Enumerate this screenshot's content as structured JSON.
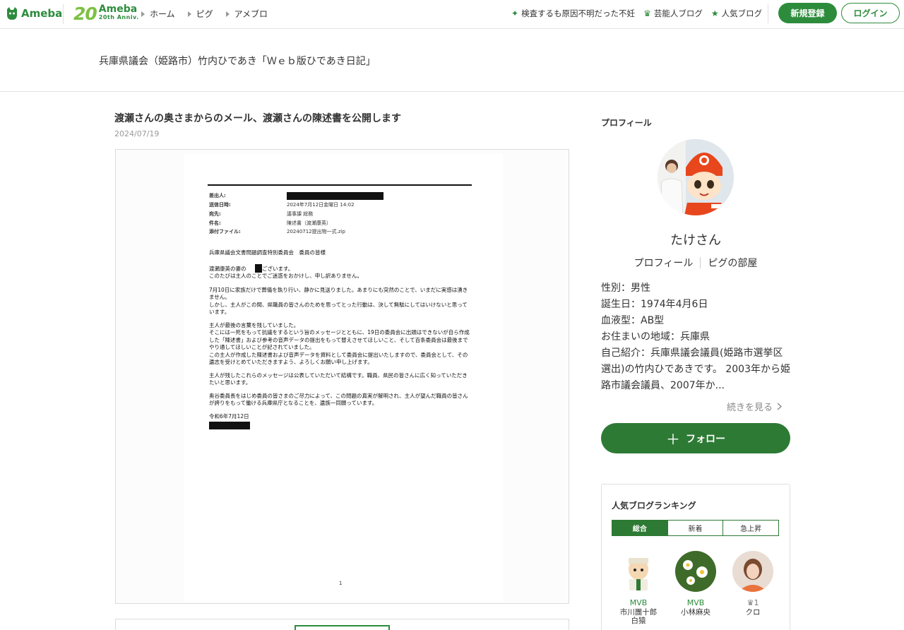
{
  "header": {
    "logo_text": "Ameba",
    "anniversary_number": "20",
    "anniversary_brand": "Ameba",
    "anniversary_sub": "20th Anniv.",
    "nav": [
      "ホーム",
      "ピグ",
      "アメブロ"
    ],
    "links": [
      {
        "icon": "sparkle-icon",
        "label": "検査するも原因不明だった不妊"
      },
      {
        "icon": "crown-icon",
        "label": "芸能人ブログ"
      },
      {
        "icon": "star-icon",
        "label": "人気ブログ"
      }
    ],
    "signup_label": "新規登録",
    "login_label": "ログイン",
    "accent_color": "#2d8c3c"
  },
  "blog": {
    "title": "兵庫県議会（姫路市）竹内ひであき「Ｗｅｂ版ひであき日記」"
  },
  "entry": {
    "title": "渡瀬さんの奥さまからのメール、渡瀬さんの陳述書を公開します",
    "date": "2024/07/19",
    "document": {
      "headers": [
        {
          "label": "差出人:",
          "value": ""
        },
        {
          "label": "送信日時:",
          "value": "2024年7月12日金曜日 14:02"
        },
        {
          "label": "宛先:",
          "value": "議事課 総務"
        },
        {
          "label": "件名:",
          "value": "陳述書（渡瀬康英）"
        },
        {
          "label": "添付ファイル:",
          "value": "20240712提出物一式.zip"
        }
      ],
      "salutation": "兵庫県議会文書問題調査特別委員会　委員の皆様",
      "paragraphs": [
        "渡瀬康英の妻の　　でございます。\nこのたびは主人のことでご迷惑をおかけし、申し訳ありません。",
        "7月10日に家族だけで葬儀を執り行い、静かに見送りました。あまりにも突然のことで、いまだに実感は湧きません。\nしかし、主人がこの間、県職員の皆さんのためを思ってとった行動は、決して無駄にしてはいけないと思っています。",
        "主人が最後の言葉を残していました。\nそこには一死をもって抗議をするという旨のメッセージとともに、19日の委員会に出頭はできないが自ら作成した「陳述書」および参考の音声データの提出をもって替えさせてほしいこと、そして百条委員会は最後までやり通してほしいことが記されていました。\nこの主人が作成した陳述書および音声データを資料として委員会に提出いたしますので、委員会として、その遺志を受けとめていただきますよう、よろしくお願い申し上げます。",
        "主人が残したこれらのメッセージは公表していただいて結構です。職員、県民の皆さんに広く知っていただきたいと思います。",
        "奥谷委員長をはじめ委員の皆さまのご尽力によって、この問題の真実が解明され、主人が望んだ職員の皆さんが誇りをもって働ける兵庫県庁となることを、遺族一同願っています。"
      ],
      "closing_date": "令和6年7月12日",
      "page_number": "1"
    }
  },
  "profile": {
    "heading": "プロフィール",
    "nickname": "たけさん",
    "links": [
      "プロフィール",
      "ピグの部屋"
    ],
    "info": [
      "性別：男性",
      "誕生日：1974年4月6日",
      "血液型：AB型",
      "お住まいの地域：兵庫県",
      "自己紹介：兵庫県議会議員(姫路市選挙区選出)の竹内ひであきです。 2003年から姫路市議会議員、2007年か..."
    ],
    "more_label": "続きを見る",
    "follow_label": "フォロー"
  },
  "ranking": {
    "heading": "人気ブログランキング",
    "tabs": [
      "総合",
      "新着",
      "急上昇"
    ],
    "active_tab": 0,
    "items": [
      {
        "badge": "MVB",
        "name": "市川團十郎\n白猿"
      },
      {
        "badge": "MVB",
        "name": "小林麻央"
      },
      {
        "badge": "1",
        "name": "クロ"
      }
    ]
  }
}
